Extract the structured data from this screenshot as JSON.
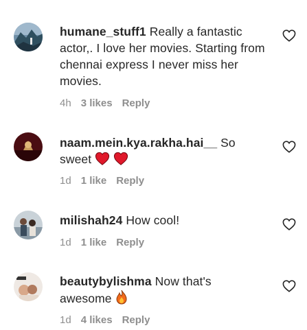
{
  "comments": [
    {
      "username": "humane_stuff1",
      "text_line1": " Really a fantastic",
      "text_rest": "actor,. I love her movies. Starting from chennai express I never miss her movies.",
      "time": "4h",
      "likes": "3 likes",
      "reply": "Reply",
      "avatar_icon": "mountain-avatar-icon"
    },
    {
      "username": "naam.mein.kya.rakha.hai__",
      "text_line1": " So",
      "text_rest": "sweet",
      "emoji": [
        "red-heart-icon",
        "red-heart-icon"
      ],
      "time": "1d",
      "likes": "1 like",
      "reply": "Reply",
      "avatar_icon": "dark-red-avatar-icon"
    },
    {
      "username": "milishah24",
      "text_line1": " How cool!",
      "time": "1d",
      "likes": "1 like",
      "reply": "Reply",
      "avatar_icon": "couple-photo-avatar-icon"
    },
    {
      "username": "beautybylishma",
      "text_line1": " Now that's",
      "text_rest": "awesome",
      "emoji": [
        "fire-icon"
      ],
      "time": "1d",
      "likes": "4 likes",
      "reply": "Reply",
      "avatar_icon": "vogue-cover-avatar-icon"
    }
  ]
}
